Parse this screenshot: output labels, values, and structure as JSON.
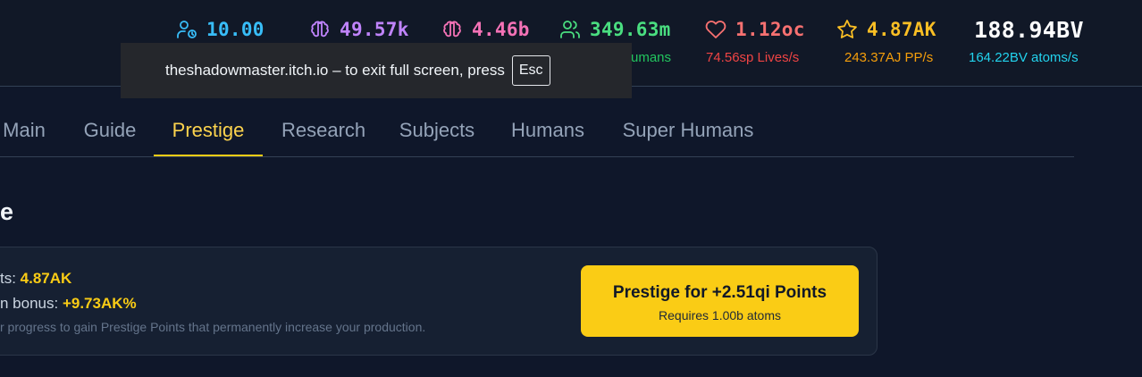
{
  "header": {
    "stats": [
      {
        "id": "time",
        "icon": "user-clock-icon",
        "value": "10.00"
      },
      {
        "id": "brain1",
        "icon": "brain-icon",
        "value": "49.57k"
      },
      {
        "id": "brain2",
        "icon": "brain-icon",
        "value": "4.46b"
      },
      {
        "id": "humans",
        "icon": "users-icon",
        "value": "349.63m",
        "rate": "umans"
      },
      {
        "id": "lives",
        "icon": "heart-icon",
        "value": "1.12oc",
        "rate": "74.56sp Lives/s"
      },
      {
        "id": "pp",
        "icon": "star-icon",
        "value": "4.87AK",
        "rate": "243.37AJ PP/s"
      },
      {
        "id": "atoms",
        "value": "188.94BV",
        "rate": "164.22BV atoms/s"
      }
    ]
  },
  "fullscreen_notice": {
    "text": "theshadowmaster.itch.io – to exit full screen, press",
    "key": "Esc"
  },
  "tabs": [
    {
      "label": "Main"
    },
    {
      "label": "Guide"
    },
    {
      "label": "Prestige",
      "active": true
    },
    {
      "label": "Research"
    },
    {
      "label": "Subjects"
    },
    {
      "label": "Humans"
    },
    {
      "label": "Super Humans"
    }
  ],
  "section": {
    "title": "e"
  },
  "prestige": {
    "points_label": "ts: ",
    "points_value": "4.87AK",
    "bonus_label": "n bonus: ",
    "bonus_value": "+9.73AK%",
    "description": "r progress to gain Prestige Points that permanently increase your production.",
    "button_label": "Prestige for +2.51qi Points",
    "button_sub": "Requires 1.00b atoms"
  },
  "colors": {
    "background": "#0f172a",
    "accent": "#facc15",
    "active_tab": "#fcd34d"
  }
}
